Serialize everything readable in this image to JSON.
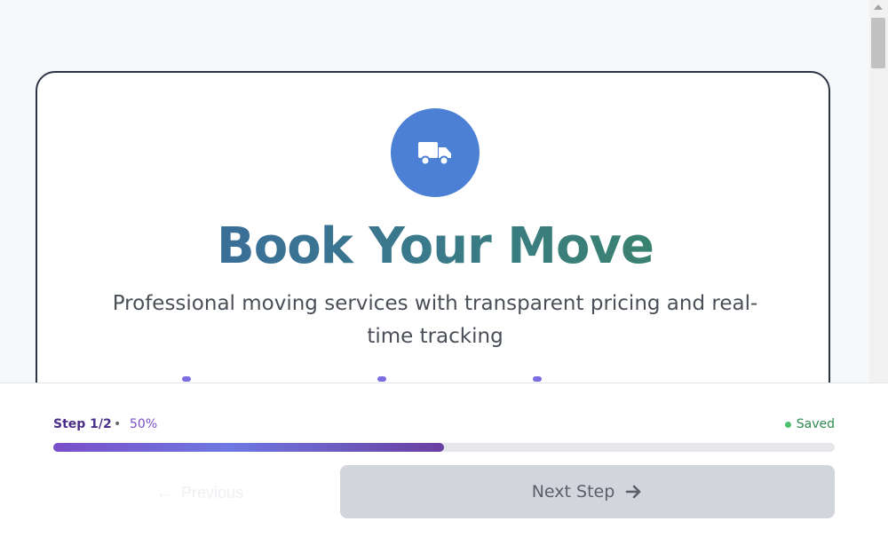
{
  "hero": {
    "icon": "truck-icon",
    "title": "Book Your Move",
    "subtitle": "Professional moving services with transparent pricing and real-time tracking"
  },
  "progress": {
    "step_label": "Step 1/2",
    "separator": "•",
    "percent_label": "50%",
    "fraction": 0.5,
    "saved_label": "Saved"
  },
  "nav": {
    "previous_label": "Previous",
    "next_label": "Next Step",
    "next_icon": "arrow-right-icon",
    "previous_icon": "arrow-left-icon"
  },
  "colors": {
    "accent": "#4c80d4",
    "progress_start": "#7a4fc7",
    "saved_dot": "#4cc06a",
    "disabled_button": "#d3d5dd"
  }
}
